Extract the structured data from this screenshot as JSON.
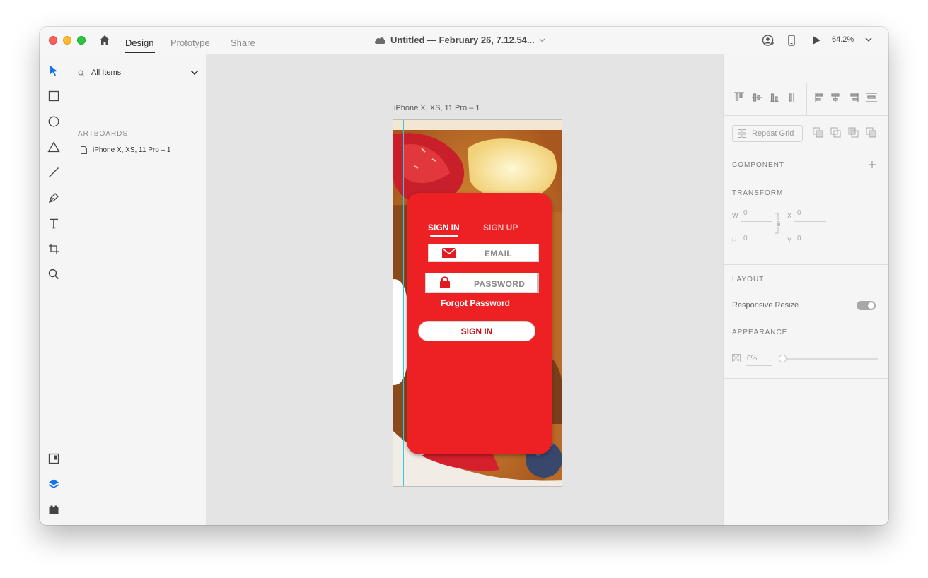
{
  "titlebar": {
    "tabs": [
      {
        "label": "Design",
        "active": true
      },
      {
        "label": "Prototype",
        "active": false
      },
      {
        "label": "Share",
        "active": false
      }
    ],
    "document_title": "Untitled — February 26, 7.12.54...",
    "zoom": "64.2%"
  },
  "layers": {
    "search_label": "All Items",
    "section_label": "ARTBOARDS",
    "artboard_name": "iPhone X, XS, 11 Pro – 1"
  },
  "canvas": {
    "artboard_label": "iPhone X, XS, 11 Pro – 1",
    "auth": {
      "tab_signin": "SIGN IN",
      "tab_signup": "SIGN UP",
      "email_placeholder": "EMAIL",
      "password_placeholder": "PASSWORD",
      "forgot": "Forgot Password",
      "signin_button": "SIGN IN"
    }
  },
  "properties": {
    "repeat_grid": "Repeat Grid",
    "component_label": "COMPONENT",
    "transform_label": "TRANSFORM",
    "w_label": "W",
    "w_value": "0",
    "x_label": "X",
    "x_value": "0",
    "h_label": "H",
    "h_value": "0",
    "y_label": "Y",
    "y_value": "0",
    "layout_label": "LAYOUT",
    "responsive_resize": "Responsive Resize",
    "appearance_label": "APPEARANCE",
    "opacity": "0%"
  },
  "colors": {
    "accent_red": "#ed2024",
    "selection_blue": "#1473e6",
    "guide_cyan": "#33c9e6"
  },
  "icons": [
    "home-icon",
    "cloud-icon",
    "user-icon",
    "phone-icon",
    "play-icon",
    "chevron-down-icon",
    "select-icon",
    "rectangle-icon",
    "ellipse-icon",
    "triangle-icon",
    "line-icon",
    "pen-icon",
    "text-icon",
    "artboard-icon",
    "zoom-icon",
    "assets-icon",
    "layers-icon",
    "plugins-icon",
    "search-icon",
    "file-icon",
    "mail-icon",
    "lock-icon"
  ]
}
